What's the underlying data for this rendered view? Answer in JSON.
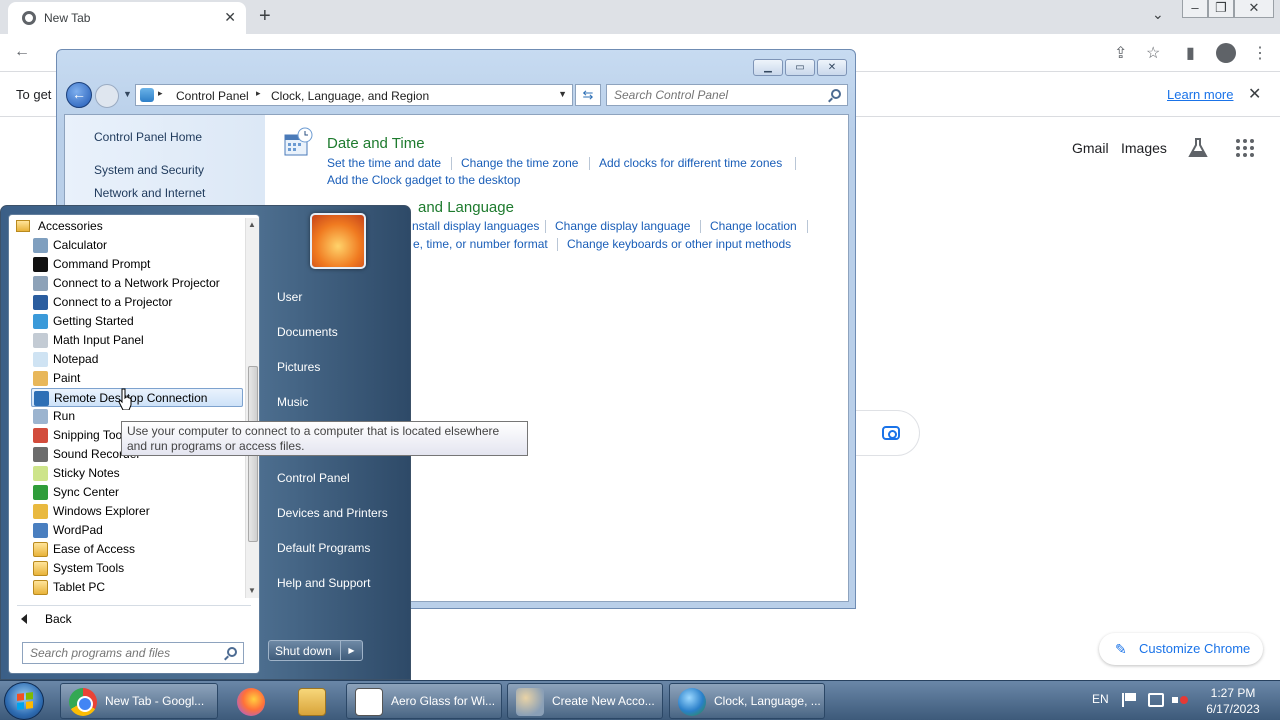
{
  "chrome": {
    "tab_title": "New Tab",
    "infobar_text": "To get",
    "infobar_learn_more": "Learn more",
    "gmail": "Gmail",
    "images": "Images",
    "customize": "Customize Chrome"
  },
  "control_panel": {
    "breadcrumb": [
      "Control Panel",
      "Clock, Language, and Region"
    ],
    "search_placeholder": "Search Control Panel",
    "nav": [
      "Control Panel Home",
      "System and Security",
      "Network and Internet"
    ],
    "date_time": {
      "title": "Date and Time",
      "links": [
        "Set the time and date",
        "Change the time zone",
        "Add clocks for different time zones",
        "Add the Clock gadget to the desktop"
      ]
    },
    "region_language": {
      "title_visible": "and Language",
      "links": [
        "nstall display languages",
        "Change display language",
        "Change location",
        "e, time, or number format",
        "Change keyboards or other input methods"
      ]
    }
  },
  "start_menu": {
    "folder": "Accessories",
    "items": [
      {
        "label": "Calculator",
        "icon": "calculator-icon",
        "color": "#7f9fbf"
      },
      {
        "label": "Command Prompt",
        "icon": "command-prompt-icon",
        "color": "#111111"
      },
      {
        "label": "Connect to a Network Projector",
        "icon": "network-projector-icon",
        "color": "#8da2b8"
      },
      {
        "label": "Connect to a Projector",
        "icon": "projector-icon",
        "color": "#2a5d9f"
      },
      {
        "label": "Getting Started",
        "icon": "getting-started-icon",
        "color": "#3b9ad9"
      },
      {
        "label": "Math Input Panel",
        "icon": "math-input-icon",
        "color": "#c3cbd4"
      },
      {
        "label": "Notepad",
        "icon": "notepad-icon",
        "color": "#cfe3f3"
      },
      {
        "label": "Paint",
        "icon": "paint-icon",
        "color": "#e8b75a"
      },
      {
        "label": "Remote Desktop Connection",
        "icon": "remote-desktop-icon",
        "color": "#2e6fb5"
      },
      {
        "label": "Run",
        "icon": "run-icon",
        "color": "#9cb4cf"
      },
      {
        "label": "Snipping Tool",
        "icon": "snipping-tool-icon",
        "color": "#d24c3c"
      },
      {
        "label": "Sound Recorder",
        "icon": "sound-recorder-icon",
        "color": "#6c6c6c"
      },
      {
        "label": "Sticky Notes",
        "icon": "sticky-notes-icon",
        "color": "#cde48a"
      },
      {
        "label": "Sync Center",
        "icon": "sync-center-icon",
        "color": "#2f9d3a"
      },
      {
        "label": "Windows Explorer",
        "icon": "windows-explorer-icon",
        "color": "#e9b93f"
      },
      {
        "label": "WordPad",
        "icon": "wordpad-icon",
        "color": "#4a7fc0"
      },
      {
        "label": "Ease of Access",
        "icon": "folder-icon",
        "color": "#e8b33a"
      },
      {
        "label": "System Tools",
        "icon": "folder-icon",
        "color": "#e8b33a"
      },
      {
        "label": "Tablet PC",
        "icon": "folder-icon",
        "color": "#e8b33a"
      }
    ],
    "back": "Back",
    "search_placeholder": "Search programs and files",
    "right_items": [
      "User",
      "Documents",
      "Pictures",
      "Music",
      "Control Panel",
      "Devices and Printers",
      "Default Programs",
      "Help and Support"
    ],
    "shutdown": "Shut down",
    "tooltip": "Use your computer to connect to a computer that is located elsewhere and run programs or access files."
  },
  "taskbar": {
    "items": [
      {
        "label": "New Tab - Googl...",
        "icon": "chrome-icon"
      },
      {
        "label": "",
        "icon": "firefox-icon"
      },
      {
        "label": "",
        "icon": "windows-explorer-icon"
      },
      {
        "label": "Aero Glass for Wi...",
        "icon": "notepad-icon"
      },
      {
        "label": "Create New Acco...",
        "icon": "user-accounts-icon"
      },
      {
        "label": "Clock, Language, ...",
        "icon": "globe-clock-icon"
      }
    ],
    "lang": "EN",
    "time": "1:27 PM",
    "date": "6/17/2023"
  }
}
